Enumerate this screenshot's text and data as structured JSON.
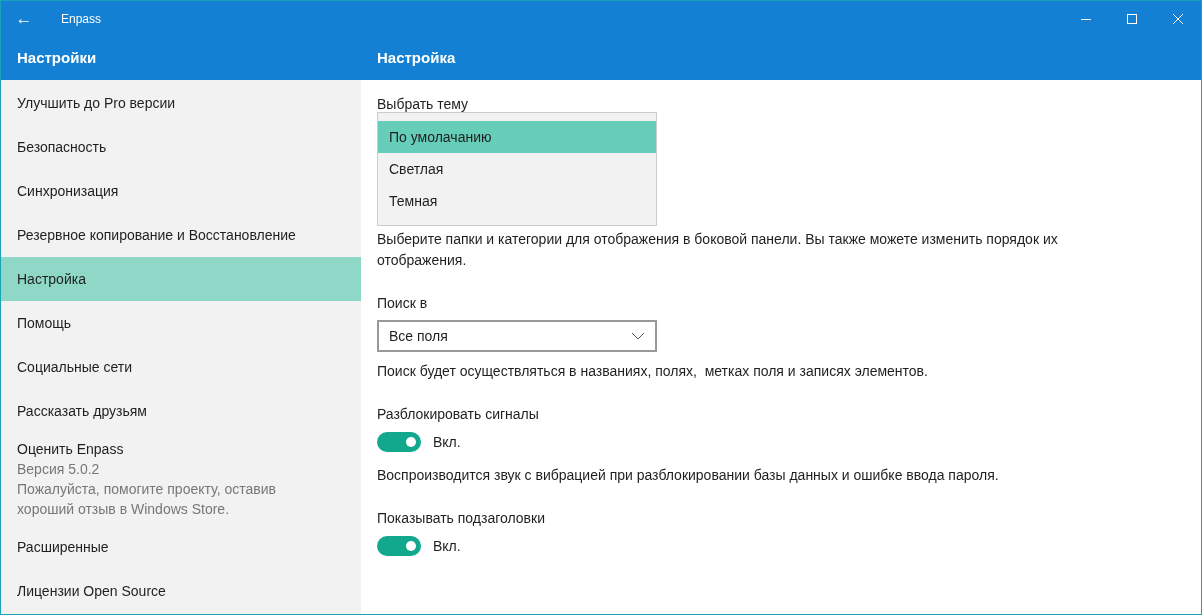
{
  "window": {
    "title": "Enpass",
    "back": "←"
  },
  "sidebar": {
    "title": "Настройки",
    "items": [
      {
        "label": "Улучшить до Pro версии",
        "selected": false
      },
      {
        "label": "Безопасность",
        "selected": false
      },
      {
        "label": "Синхронизация",
        "selected": false
      },
      {
        "label": "Резервное копирование и Восстановление",
        "selected": false
      },
      {
        "label": "Настройка",
        "selected": true
      },
      {
        "label": "Помощь",
        "selected": false
      },
      {
        "label": "Социальные сети",
        "selected": false
      },
      {
        "label": "Рассказать друзьям",
        "selected": false
      },
      {
        "label": "Оценить Enpass",
        "selected": false,
        "details": [
          "Версия 5.0.2",
          "Пожалуйста, помогите проекту, оставив хороший отзыв в Windows Store."
        ]
      },
      {
        "label": "Расширенные",
        "selected": false
      },
      {
        "label": "Лицензии Open Source",
        "selected": false
      }
    ]
  },
  "content": {
    "title": "Настройка",
    "sections": [
      {
        "kind": "theme",
        "label": "Выбрать тему",
        "options": [
          {
            "label": "По умолачанию",
            "selected": true
          },
          {
            "label": "Светлая",
            "selected": false
          },
          {
            "label": "Темная",
            "selected": false
          }
        ]
      },
      {
        "kind": "text",
        "text": "Выберите папки и категории для отображения в боковой панели. Вы также можете изменить порядок их отображения."
      },
      {
        "kind": "select",
        "label": "Поиск в",
        "value": "Все поля"
      },
      {
        "kind": "text",
        "text": "Поиск будет осуществляться в названиях, полях,  метках поля и записях элементов."
      },
      {
        "kind": "toggle",
        "label": "Разблокировать сигналы",
        "on": true,
        "state": "Вкл."
      },
      {
        "kind": "text",
        "text": "Воспроизводится звук с вибрацией при разблокировании базы данных и ошибке ввода пароля."
      },
      {
        "kind": "toggle",
        "label": "Показывать подзаголовки",
        "on": true,
        "state": "Вкл."
      }
    ]
  }
}
